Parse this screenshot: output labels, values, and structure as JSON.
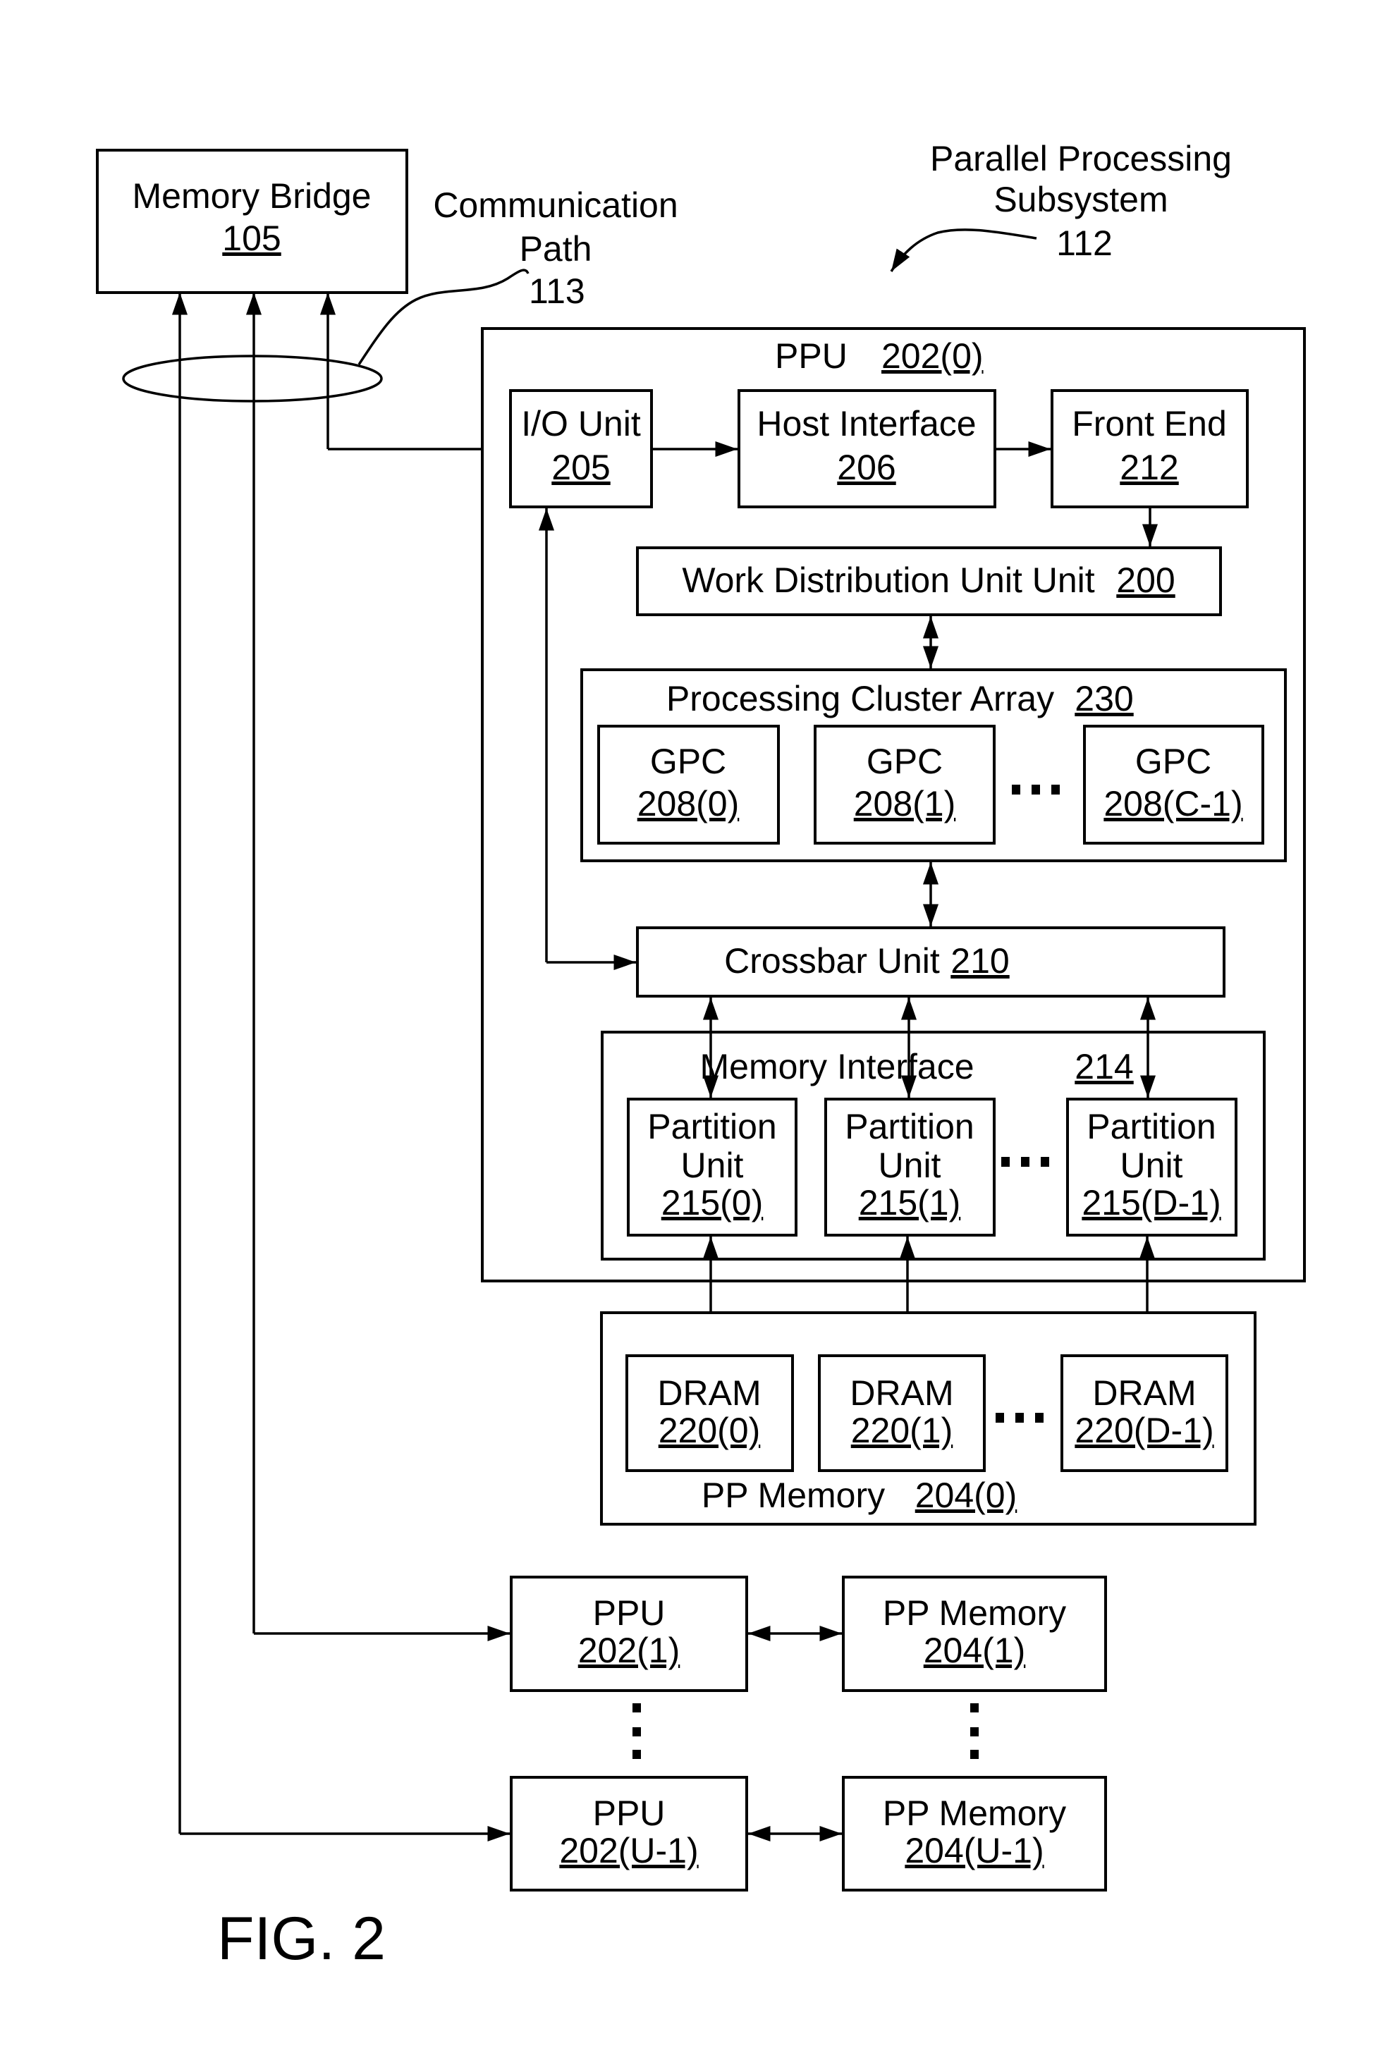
{
  "figure": {
    "title": "FIG. 2"
  },
  "colors": {
    "line": "#000000",
    "background": "#ffffff"
  },
  "subsystem": {
    "line1": "Parallel Processing",
    "line2": "Subsystem",
    "ref": "112"
  },
  "comm_path": {
    "line1": "Communication",
    "line2": "Path",
    "ref": "113"
  },
  "memory_bridge": {
    "label": "Memory Bridge",
    "ref": "105"
  },
  "ppu0": {
    "label": "PPU",
    "ref": "202(0)",
    "io_unit": {
      "label": "I/O Unit",
      "ref": "205"
    },
    "host_interface": {
      "label": "Host Interface",
      "ref": "206"
    },
    "front_end": {
      "label": "Front End",
      "ref": "212"
    },
    "work_distribution": {
      "label": "Work Distribution Unit Unit",
      "ref": "200"
    },
    "pca": {
      "label": "Processing Cluster Array",
      "ref": "230",
      "gpcs": [
        {
          "label": "GPC",
          "ref": "208(0)"
        },
        {
          "label": "GPC",
          "ref": "208(1)"
        },
        {
          "label": "GPC",
          "ref": "208(C-1)"
        }
      ]
    },
    "crossbar": {
      "label": "Crossbar Unit",
      "ref": "210"
    },
    "memory_interface": {
      "label": "Memory Interface",
      "ref": "214",
      "partitions": [
        {
          "line1": "Partition",
          "line2": "Unit",
          "ref": "215(0)"
        },
        {
          "line1": "Partition",
          "line2": "Unit",
          "ref": "215(1)"
        },
        {
          "line1": "Partition",
          "line2": "Unit",
          "ref": "215(D-1)"
        }
      ]
    }
  },
  "pp_memory0": {
    "label": "PP Memory",
    "ref": "204(0)",
    "drams": [
      {
        "label": "DRAM",
        "ref": "220(0)"
      },
      {
        "label": "DRAM",
        "ref": "220(1)"
      },
      {
        "label": "DRAM",
        "ref": "220(D-1)"
      }
    ]
  },
  "ppu1": {
    "label": "PPU",
    "ref": "202(1)"
  },
  "pp_memory1": {
    "label": "PP Memory",
    "ref": "204(1)"
  },
  "ppu_last": {
    "label": "PPU",
    "ref": "202(U-1)"
  },
  "pp_memory_last": {
    "label": "PP Memory",
    "ref": "204(U-1)"
  }
}
